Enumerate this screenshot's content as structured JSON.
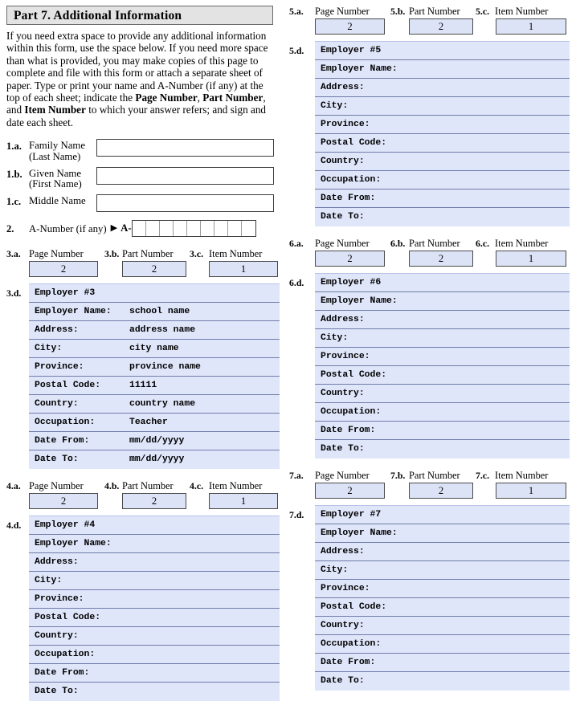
{
  "part": {
    "header": "Part 7.  Additional Information",
    "intro_plain": "If you need extra space to provide any additional information within this form, use the space below.  If you need more space than what is provided, you may make copies of this page to complete and file with this form or attach a separate sheet of paper.  Type or print your name and A-Number (if any) at the top of each sheet; indicate the ",
    "intro_b1": "Page Number",
    "intro_sep1": ", ",
    "intro_b2": "Part Number",
    "intro_sep2": ", and ",
    "intro_b3": "Item Number",
    "intro_tail": " to which your answer refers; and sign and date each sheet."
  },
  "names": {
    "family": {
      "index": "1.a.",
      "label_line1": "Family Name",
      "label_line2": "(Last Name)",
      "value": "",
      "placeholder": ""
    },
    "given": {
      "index": "1.b.",
      "label_line1": "Given Name",
      "label_line2": "(First Name)",
      "value": "",
      "placeholder": ""
    },
    "middle": {
      "index": "1.c.",
      "label_line1": "Middle Name",
      "label_line2": "",
      "value": "",
      "placeholder": ""
    }
  },
  "anumber": {
    "index": "2.",
    "label": "A-Number (if any)",
    "arrow": "▶",
    "prefix": "A-",
    "cells": [
      "",
      "",
      "",
      "",
      "",
      "",
      "",
      "",
      ""
    ]
  },
  "field_labels": {
    "page_number": "Page Number",
    "part_number": "Part Number",
    "item_number": "Item Number"
  },
  "row_keys": {
    "employer_name": "Employer Name:",
    "address": "Address:",
    "city": "City:",
    "province": "Province:",
    "postal_code": "Postal Code:",
    "country": "Country:",
    "occupation": "Occupation:",
    "date_from": "Date From:",
    "date_to": "Date To:"
  },
  "colors": {
    "field_fill": "#dde3f7",
    "table_fill": "#e0e6fa",
    "table_rule": "#6d7ba8",
    "header_fill": "#e3e3e3",
    "border": "#4a4a4a"
  },
  "sections": [
    {
      "id": "s3",
      "idx_a": "3.a.",
      "idx_b": "3.b.",
      "idx_c": "3.c.",
      "idx_d": "3.d.",
      "page_number": "2",
      "part_number": "2",
      "item_number": "1",
      "title": "Employer #3",
      "values": {
        "employer_name": "school name",
        "address": "address name",
        "city": "city name",
        "province": "province name",
        "postal_code": "11111",
        "country": "country name",
        "occupation": "Teacher",
        "date_from": "mm/dd/yyyy",
        "date_to": "mm/dd/yyyy"
      }
    },
    {
      "id": "s4",
      "idx_a": "4.a.",
      "idx_b": "4.b.",
      "idx_c": "4.c.",
      "idx_d": "4.d.",
      "page_number": "2",
      "part_number": "2",
      "item_number": "1",
      "title": "Employer #4",
      "values": {
        "employer_name": "",
        "address": "",
        "city": "",
        "province": "",
        "postal_code": "",
        "country": "",
        "occupation": "",
        "date_from": "",
        "date_to": ""
      }
    },
    {
      "id": "s5",
      "idx_a": "5.a.",
      "idx_b": "5.b.",
      "idx_c": "5.c.",
      "idx_d": "5.d.",
      "page_number": "2",
      "part_number": "2",
      "item_number": "1",
      "title": "Employer #5",
      "values": {
        "employer_name": "",
        "address": "",
        "city": "",
        "province": "",
        "postal_code": "",
        "country": "",
        "occupation": "",
        "date_from": "",
        "date_to": ""
      }
    },
    {
      "id": "s6",
      "idx_a": "6.a.",
      "idx_b": "6.b.",
      "idx_c": "6.c.",
      "idx_d": "6.d.",
      "page_number": "2",
      "part_number": "2",
      "item_number": "1",
      "title": "Employer #6",
      "values": {
        "employer_name": "",
        "address": "",
        "city": "",
        "province": "",
        "postal_code": "",
        "country": "",
        "occupation": "",
        "date_from": "",
        "date_to": ""
      }
    },
    {
      "id": "s7",
      "idx_a": "7.a.",
      "idx_b": "7.b.",
      "idx_c": "7.c.",
      "idx_d": "7.d.",
      "page_number": "2",
      "part_number": "2",
      "item_number": "1",
      "title": "Employer #7",
      "values": {
        "employer_name": "",
        "address": "",
        "city": "",
        "province": "",
        "postal_code": "",
        "country": "",
        "occupation": "",
        "date_from": "",
        "date_to": ""
      }
    }
  ]
}
